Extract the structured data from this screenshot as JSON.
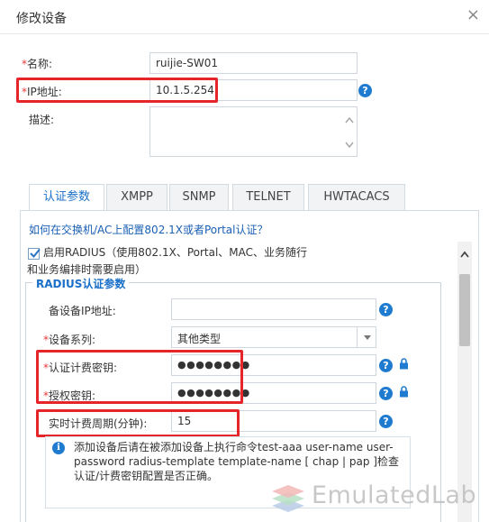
{
  "dialog": {
    "title": "修改设备",
    "close_glyph": "×"
  },
  "fields": {
    "name": {
      "required_mark": "*",
      "label": "名称:",
      "value": "ruijie-SW01"
    },
    "ip": {
      "required_mark": "*",
      "label": "IP地址:",
      "value": "10.1.5.254"
    },
    "desc": {
      "label": "描述:",
      "value": ""
    }
  },
  "tabs": [
    {
      "label": "认证参数",
      "active": true
    },
    {
      "label": "XMPP",
      "active": false
    },
    {
      "label": "SNMP",
      "active": false
    },
    {
      "label": "TELNET",
      "active": false
    },
    {
      "label": "HWTACACS",
      "active": false
    }
  ],
  "auth": {
    "help_link": "如何在交换机/AC上配置802.1X或者Portal认证？",
    "radius_enable": {
      "checked": true,
      "label_line1": "启用RADIUS（使用802.1X、Portal、MAC、业务随行",
      "label_line2": "和业务编排时需要启用）"
    },
    "radius_params": {
      "legend": "RADIUS认证参数",
      "backup_ip": {
        "label": "备设备IP地址:",
        "value": ""
      },
      "device_series": {
        "required_mark": "*",
        "label": "设备系列:",
        "value": "其他类型"
      },
      "acct_key": {
        "required_mark": "*",
        "label": "认证计费密钥:",
        "value": "●●●●●●●●"
      },
      "auth_key": {
        "required_mark": "*",
        "label": "授权密钥:",
        "value": "●●●●●●●●"
      },
      "realtime_period": {
        "label": "实时计费周期(分钟):",
        "value": "15"
      }
    },
    "notice": "添加设备后请在被添加设备上执行命令test-aaa user-name user-password radius-template template-name [ chap | pap ]检查认证/计费密钥配置是否正确。"
  },
  "icons": {
    "help": "?",
    "info": "i",
    "scroll_up": "▲"
  },
  "watermark": {
    "text": "EmulatedLab"
  },
  "colors": {
    "highlight": "#e5252a",
    "accent": "#1a6fc9",
    "required": "#e4393c"
  }
}
